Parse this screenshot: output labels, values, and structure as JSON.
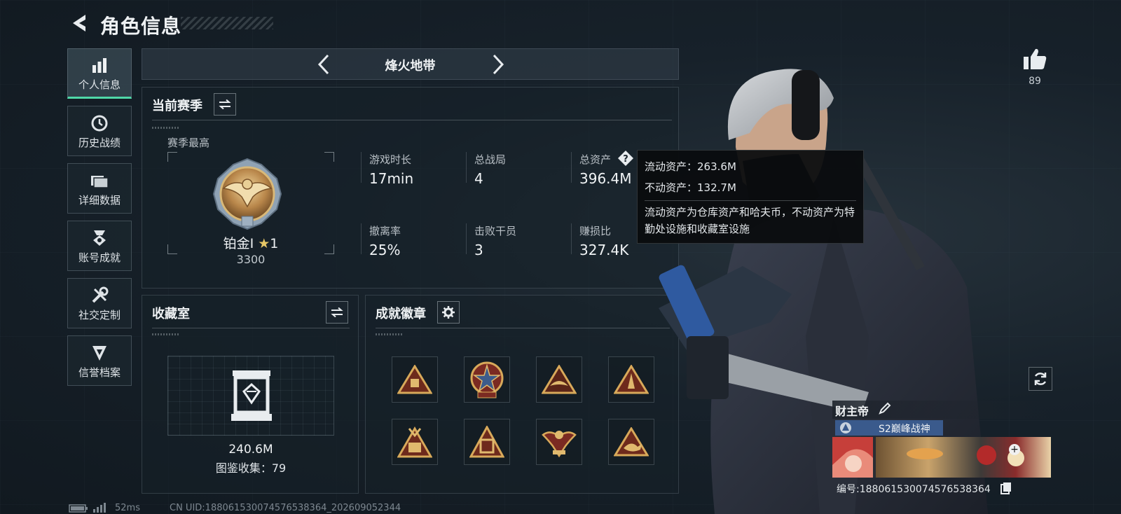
{
  "header": {
    "title": "角色信息"
  },
  "sidebar": {
    "items": [
      {
        "label": "个人信息",
        "icon": "bar-chart-icon",
        "active": true
      },
      {
        "label": "历史战绩",
        "icon": "history-icon"
      },
      {
        "label": "详细数据",
        "icon": "folder-icon"
      },
      {
        "label": "账号成就",
        "icon": "achievement-icon"
      },
      {
        "label": "社交定制",
        "icon": "tools-icon"
      },
      {
        "label": "信誉档案",
        "icon": "credit-icon"
      }
    ]
  },
  "mode": {
    "name": "烽火地带"
  },
  "season": {
    "title": "当前赛季",
    "best_label": "赛季最高",
    "rank_name": "铂金Ⅰ",
    "rank_stars": "1",
    "rank_points": "3300",
    "stats": [
      {
        "label": "游戏时长",
        "value": "17min"
      },
      {
        "label": "总战局",
        "value": "4"
      },
      {
        "label": "总资产",
        "value": "396.4M"
      },
      {
        "label": "撤离率",
        "value": "25%"
      },
      {
        "label": "击败干员",
        "value": "3"
      },
      {
        "label": "赚损比",
        "value": "327.4K"
      }
    ]
  },
  "tooltip": {
    "liquid": "流动资产：263.6M",
    "fixed": "不动资产：132.7M",
    "desc": "流动资产为仓库资产和哈夫币，不动资产为特勤处设施和收藏室设施"
  },
  "collection": {
    "title": "收藏室",
    "value": "240.6M",
    "catalog": "图鉴收集：79"
  },
  "achievements": {
    "title": "成就徽章",
    "count": 8
  },
  "likes": {
    "count": "89"
  },
  "player": {
    "name": "财主帝",
    "title": "S2巅峰战神",
    "id_text": "编号:188061530074576538364"
  },
  "footer": {
    "ping": "52ms",
    "uid": "CN UID:188061530074576538364_202609052344"
  },
  "colors": {
    "accent": "#4fd8a8",
    "title_bar": "#3a5a8c"
  }
}
